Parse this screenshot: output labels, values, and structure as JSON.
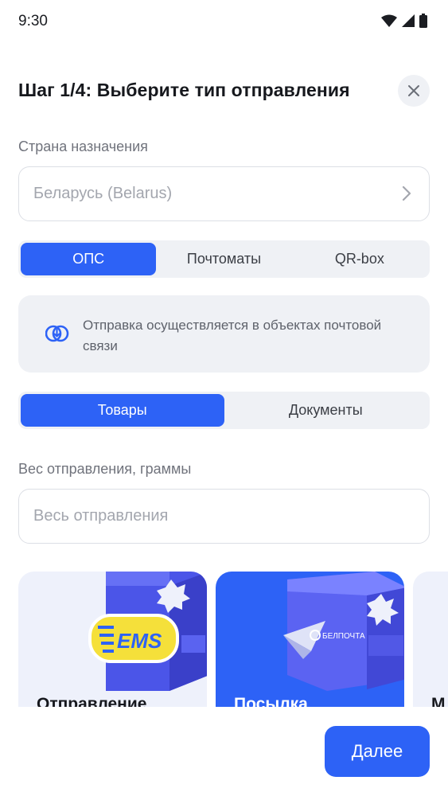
{
  "status_bar": {
    "time": "9:30"
  },
  "header": {
    "title": "Шаг 1/4: Выберите тип отправления"
  },
  "country": {
    "label": "Страна назначения",
    "value": "Беларусь (Belarus)"
  },
  "delivery_tabs": [
    {
      "label": "ОПС",
      "active": true
    },
    {
      "label": "Почтоматы",
      "active": false
    },
    {
      "label": "QR-box",
      "active": false
    }
  ],
  "info": {
    "text": "Отправка осуществляется в объектах почтовой связи"
  },
  "content_tabs": [
    {
      "label": "Товары",
      "active": true
    },
    {
      "label": "Документы",
      "active": false
    }
  ],
  "weight": {
    "label": "Вес отправления, граммы",
    "placeholder": "Весь отправления"
  },
  "shipment_types": [
    {
      "title": "Отправление",
      "logo": "EMS",
      "active": false
    },
    {
      "title": "Посылка",
      "logo": "БЕЛПОЧТА",
      "active": true
    },
    {
      "title": "М",
      "active": false
    }
  ],
  "footer": {
    "next_label": "Далее"
  },
  "colors": {
    "accent": "#2d62f6",
    "surface": "#eff1f5"
  }
}
